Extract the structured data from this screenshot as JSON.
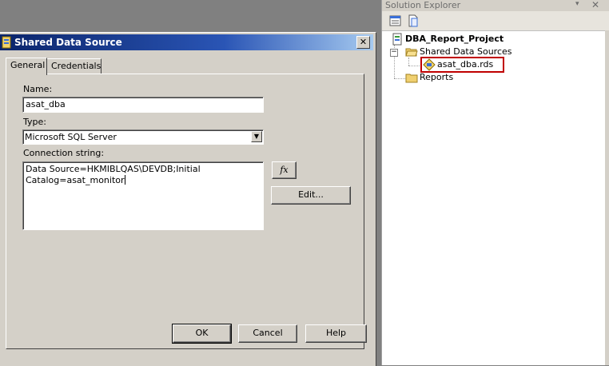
{
  "dialog": {
    "title": "Shared Data Source",
    "close_glyph": "✕",
    "tabs": [
      {
        "label": "General"
      },
      {
        "label": "Credentials"
      }
    ],
    "name_label": "Name:",
    "name_value": "asat_dba",
    "type_label": "Type:",
    "type_value": "Microsoft SQL Server",
    "connection_label": "Connection string:",
    "connection_value": "Data Source=HKMIBLQAS\\DEVDB;Initial\nCatalog=asat_monitor",
    "fx_button": "fx",
    "edit_button": "Edit...",
    "ok_button": "OK",
    "cancel_button": "Cancel",
    "help_button": "Help"
  },
  "solution_explorer": {
    "title": "Solution Explorer",
    "pin_glyph": "▾",
    "close_glyph": "✕",
    "tree": {
      "project": "DBA_Report_Project",
      "shared_data_sources": "Shared Data Sources",
      "data_source_file": "asat_dba.rds",
      "reports": "Reports"
    }
  },
  "colors": {
    "title_bar": "#0a246a",
    "highlight_border": "#c00000",
    "dialog_face": "#d4d0c8"
  }
}
